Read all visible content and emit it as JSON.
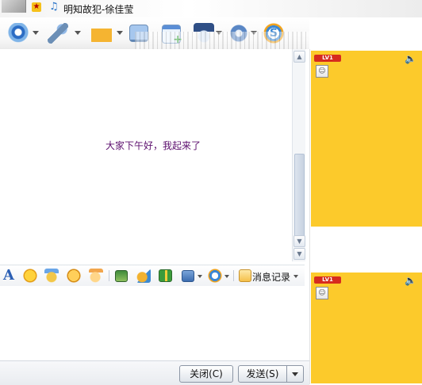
{
  "title_bar": {
    "song_title": "明知故犯-徐佳莹",
    "star_glyph": "★",
    "music_glyph": "♫",
    "icons": [
      "avatar-thumbnail",
      "star-badge-icon",
      "music-note-icon"
    ]
  },
  "toolbar": {
    "buttons": [
      {
        "name": "video-chat-button",
        "icon": "webcam-icon"
      },
      {
        "name": "voice-chat-button",
        "icon": "microphone-icon"
      },
      {
        "name": "send-file-button",
        "icon": "folder-icon"
      },
      {
        "name": "remote-assist-button",
        "icon": "screen-icon"
      },
      {
        "name": "create-discussion-button",
        "icon": "note-add-icon"
      },
      {
        "name": "app-button",
        "icon": "police-icon"
      },
      {
        "name": "settings-button",
        "icon": "gear-icon"
      },
      {
        "name": "soso-button",
        "icon": "soso-s-icon"
      }
    ]
  },
  "chat": {
    "message": "大家下午好，我起来了",
    "text_color": "#5c0f6e"
  },
  "format_bar": {
    "font_label": "A",
    "history_label": "消息记录",
    "icons": [
      "font-icon",
      "emoticon-icon",
      "magic-face-icon",
      "wink-face-icon",
      "shake-icon",
      "image-icon",
      "screenshot-icon",
      "gift-icon",
      "screen-capture-icon",
      "soso-icon",
      "history-icon"
    ]
  },
  "buttons": {
    "close": "关闭(C)",
    "send": "发送(S)"
  },
  "side_panels": {
    "badge_text": "LV1",
    "speaker_glyph": "🔈",
    "user_glyph": "☺",
    "panel_color": "#fcca2b"
  }
}
